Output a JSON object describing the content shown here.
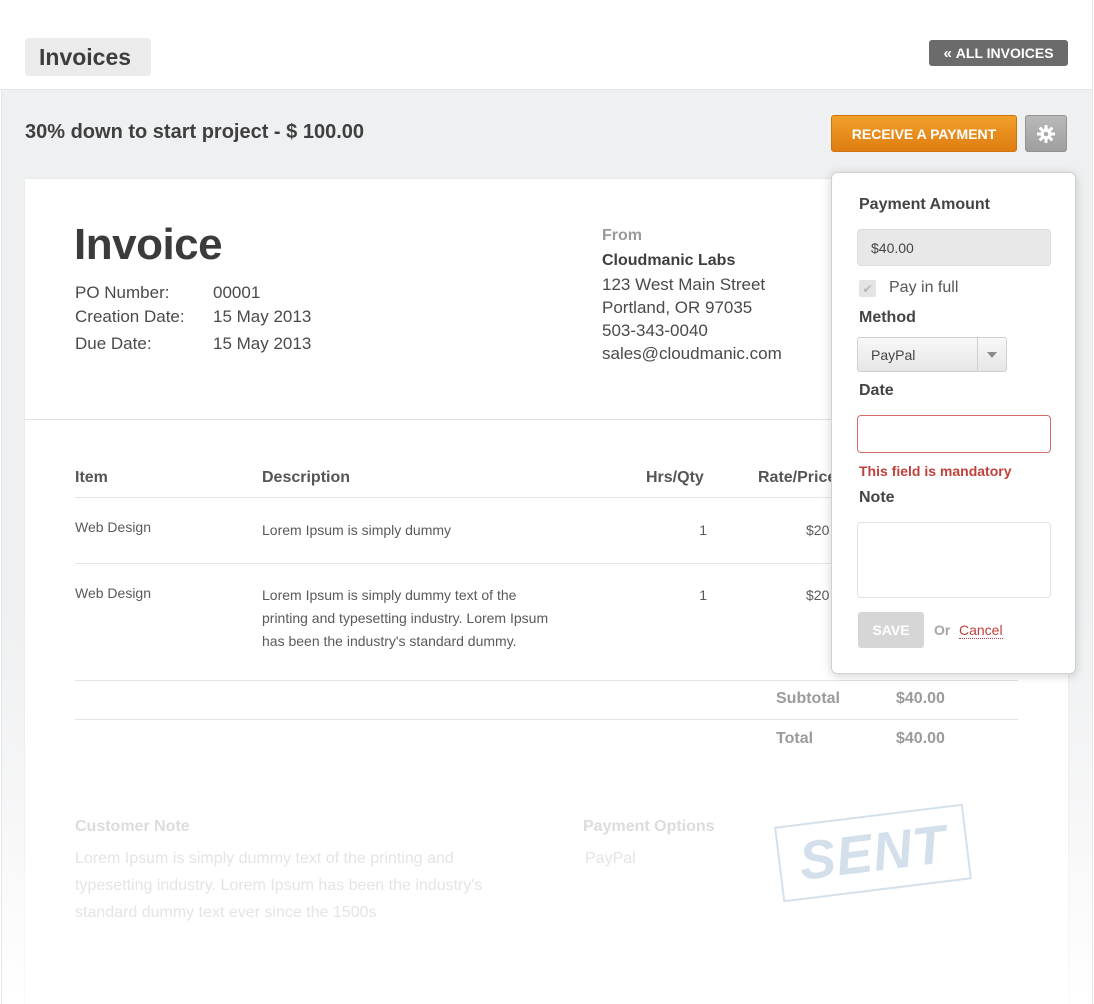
{
  "header": {
    "title": "Invoices",
    "all_invoices_label": "ALL INVOICES",
    "subtitle": "30% down to start project - $ 100.00",
    "receive_payment_label": "RECEIVE A PAYMENT"
  },
  "invoice": {
    "heading": "Invoice",
    "meta": [
      {
        "label": "PO Number:",
        "value": "00001"
      },
      {
        "label": "Creation Date:",
        "value": "15 May 2013"
      },
      {
        "label": "Due Date:",
        "value": "15 May 2013"
      }
    ],
    "from": {
      "label": "From",
      "name": "Cloudmanic Labs",
      "lines": [
        "123 West Main Street",
        "Portland, OR 97035",
        "503-343-0040",
        "sales@cloudmanic.com"
      ]
    }
  },
  "table": {
    "headers": [
      "Item",
      "Description",
      "Hrs/Qty",
      "Rate/Price"
    ],
    "rows": [
      {
        "item": "Web Design",
        "description": "Lorem Ipsum is simply dummy",
        "qty": "1",
        "rate": "$20"
      },
      {
        "item": "Web Design",
        "description_lines": [
          "Lorem Ipsum is simply dummy text of the",
          "printing and typesetting industry. Lorem Ipsum",
          "has been the industry's standard dummy."
        ],
        "qty": "1",
        "rate": "$20"
      }
    ]
  },
  "summary": {
    "subtotal_label": "Subtotal",
    "subtotal_value": "$40.00",
    "total_label": "Total",
    "total_value": "$40.00"
  },
  "footer": {
    "customer_note_title": "Customer Note",
    "customer_note_lines": [
      "Lorem Ipsum is simply dummy text of the printing and",
      "typesetting industry. Lorem Ipsum has been the industry's",
      "standard dummy text ever since the 1500s"
    ],
    "payment_options_title": "Payment Options",
    "payment_option": "PayPal",
    "stamp": "SENT"
  },
  "payment_popover": {
    "amount_label": "Payment Amount",
    "amount_value": "$40.00",
    "pay_in_full_label": "Pay in full",
    "pay_in_full_checked": true,
    "method_label": "Method",
    "method_value": "PayPal",
    "date_label": "Date",
    "date_value": "",
    "date_error": "This field is mandatory",
    "note_label": "Note",
    "note_value": "",
    "save_label": "SAVE",
    "or_label": "Or",
    "cancel_label": "Cancel"
  },
  "colors": {
    "accent": "#e8891c",
    "error": "#c0413b",
    "dark_button": "#6b6b6b"
  }
}
